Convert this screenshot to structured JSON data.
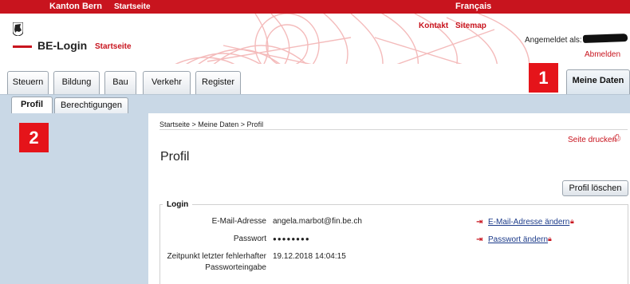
{
  "topbar": {
    "canton": "Kanton Bern",
    "start": "Startseite",
    "language": "Français"
  },
  "header": {
    "logo_text": "BE-Login",
    "logo_start": "Startseite",
    "contact": "Kontakt",
    "sitemap": "Sitemap",
    "logged_in_label": "Angemeldet als:",
    "logout": "Abmelden"
  },
  "nav": {
    "tabs": [
      {
        "label": "Steuern"
      },
      {
        "label": "Bildung"
      },
      {
        "label": "Bau"
      },
      {
        "label": "Verkehr"
      },
      {
        "label": "Register"
      }
    ],
    "active_tab": "Meine Daten"
  },
  "subnav": {
    "tabs": [
      {
        "label": "Profil"
      },
      {
        "label": "Berechtigungen"
      }
    ]
  },
  "badges": {
    "one": "1",
    "two": "2"
  },
  "main": {
    "breadcrumb": "Startseite > Meine Daten > Profil",
    "print": "Seite drucken",
    "title": "Profil",
    "delete_button": "Profil löschen",
    "login_section": {
      "legend": "Login",
      "email_label": "E-Mail-Adresse",
      "email_value": "angela.marbot@fin.be.ch",
      "email_action": "E-Mail-Adresse ändern",
      "password_label": "Passwort",
      "password_value": "●●●●●●●●",
      "password_action": "Passwort ändern",
      "failed_label_1": "Zeitpunkt letzter fehlerhafter",
      "failed_label_2": "Passworteingabe",
      "failed_value": "19.12.2018 14:04:15"
    }
  },
  "colors": {
    "brand_red": "#c8141e",
    "badge_red": "#e5141a",
    "sidebar_blue": "#c9d8e6",
    "link_blue": "#1c3b8a"
  }
}
